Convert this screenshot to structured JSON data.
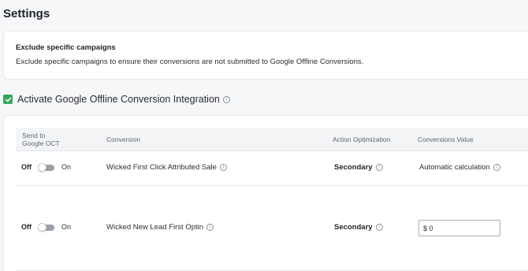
{
  "page": {
    "title": "Settings"
  },
  "exclude": {
    "title": "Exclude specific campaigns",
    "description": "Exclude specific campaigns to ensure their conversions are not submitted to Google Offline Conversions."
  },
  "activate": {
    "checked": true,
    "label": "Activate Google Offline Conversion Integration",
    "check_color": "#37a65a"
  },
  "table": {
    "headers": {
      "send_line1": "Send to",
      "send_line2": "Google OCT",
      "conversion": "Conversion",
      "action": "Action Optimization",
      "value": "Conversions Value"
    },
    "rows": [
      {
        "toggle_off": "Off",
        "toggle_on": "On",
        "conversion": "Wicked First Click Attributed Sale",
        "action": "Secondary",
        "value_text": "Automatic calculation"
      },
      {
        "toggle_off": "Off",
        "toggle_on": "On",
        "conversion": "Wicked New Lead First Optin",
        "action": "Secondary",
        "value_input": "$ 0"
      }
    ]
  },
  "icons": {
    "info": "info-icon",
    "check": "check-icon"
  }
}
